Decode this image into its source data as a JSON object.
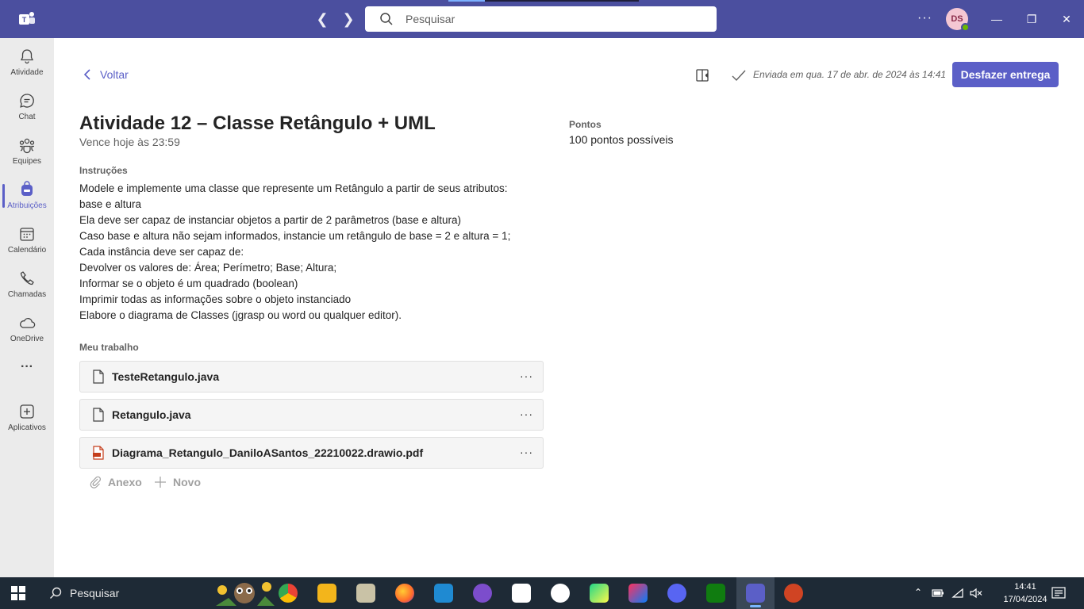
{
  "titlebar": {
    "search_placeholder": "Pesquisar",
    "avatar_initials": "DS",
    "more": "···"
  },
  "rail": {
    "items": [
      {
        "label": "Atividade",
        "icon": "bell-icon"
      },
      {
        "label": "Chat",
        "icon": "chat-icon"
      },
      {
        "label": "Equipes",
        "icon": "teams-icon"
      },
      {
        "label": "Atribuições",
        "icon": "backpack-icon",
        "active": true
      },
      {
        "label": "Calendário",
        "icon": "calendar-icon"
      },
      {
        "label": "Chamadas",
        "icon": "phone-icon"
      },
      {
        "label": "OneDrive",
        "icon": "cloud-icon"
      },
      {
        "label": "···",
        "icon": "more-icon"
      },
      {
        "label": "Aplicativos",
        "icon": "add-app-icon"
      }
    ]
  },
  "header": {
    "back_label": "Voltar",
    "submitted_text": "Enviada em qua. 17 de abr. de 2024 às 14:41",
    "undo_button": "Desfazer entrega"
  },
  "assignment": {
    "title": "Atividade 12 – Classe Retângulo + UML",
    "due": "Vence hoje às 23:59",
    "points_label": "Pontos",
    "points_value": "100 pontos possíveis",
    "instructions_label": "Instruções",
    "instructions": [
      "Modele e implemente uma classe que represente um Retângulo a partir de seus atributos:",
      "base e altura",
      "Ela deve ser capaz de instanciar objetos a partir de 2 parâmetros (base e altura)",
      "Caso base e altura não sejam informados, instancie um retângulo de base = 2 e altura = 1;",
      "Cada instância deve ser capaz de:",
      "Devolver os valores de: Área; Perímetro; Base; Altura;",
      "Informar se o objeto é um quadrado (boolean)",
      "Imprimir todas as informações sobre o objeto instanciado",
      "Elabore o diagrama de Classes (jgrasp ou word ou qualquer editor)."
    ],
    "work_label": "Meu trabalho",
    "files": [
      {
        "name": "TesteRetangulo.java",
        "type": "file"
      },
      {
        "name": "Retangulo.java",
        "type": "file"
      },
      {
        "name": "Diagrama_Retangulo_DaniloASantos_22210022.drawio.pdf",
        "type": "pdf"
      }
    ],
    "attach_label": "Anexo",
    "new_label": "Novo"
  },
  "taskbar": {
    "search_label": "Pesquisar",
    "time": "14:41",
    "date": "17/04/2024"
  },
  "colors": {
    "brand": "#4b4f9f",
    "accent": "#5b5fc7"
  }
}
